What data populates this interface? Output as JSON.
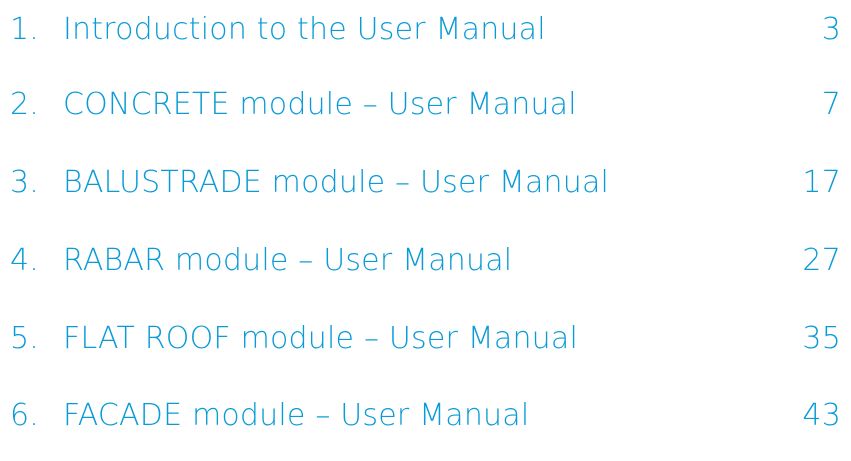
{
  "toc": {
    "entries": [
      {
        "number": "1.",
        "title": "Introduction to the User Manual",
        "page": "3"
      },
      {
        "number": "2.",
        "title": "CONCRETE module – User Manual",
        "page": "7"
      },
      {
        "number": "3.",
        "title": "BALUSTRADE module – User Manual",
        "page": "17"
      },
      {
        "number": "4.",
        "title": "RABAR module – User Manual",
        "page": "27"
      },
      {
        "number": "5.",
        "title": "FLAT ROOF module – User Manual",
        "page": "35"
      },
      {
        "number": "6.",
        "title": "FACADE module – User Manual",
        "page": "43"
      }
    ]
  },
  "colors": {
    "text": "#0a9bd7",
    "background": "#ffffff"
  }
}
